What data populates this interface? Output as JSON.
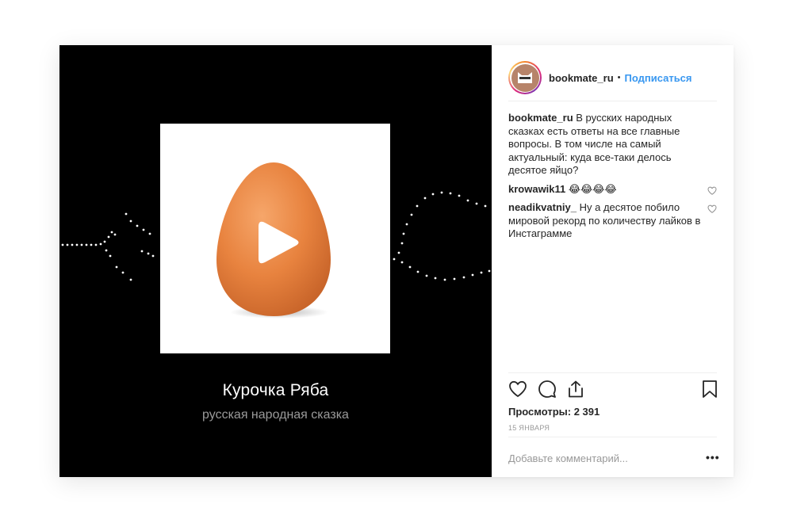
{
  "post": {
    "author": "bookmate_ru",
    "separator": "•",
    "follow_label": "Подписаться",
    "caption_text": "В русских народных сказках есть ответы на все главные вопросы. В том числе на самый актуальный: куда все-таки делось десятое яйцо?",
    "comments": [
      {
        "user": "krowawik11",
        "text": "😂😂😂😂"
      },
      {
        "user": "neadikvatniy_",
        "text": "Ну а десятое побило мировой рекорд по количеству лайков в Инстаграмме"
      }
    ],
    "views_label": "Просмотры: 2 391",
    "date": "15 ЯНВАРЯ",
    "add_comment_placeholder": "Добавьте комментарий...",
    "more_label": "•••"
  },
  "media": {
    "book_title": "Курочка Ряба",
    "book_subtitle": "русская народная сказка"
  },
  "icons": {
    "like": "heart-icon",
    "comment": "comment-icon",
    "share": "share-icon",
    "save": "bookmark-icon",
    "play": "play-icon",
    "comment_like": "heart-icon"
  },
  "colors": {
    "follow": "#3897f0",
    "media_background": "#000000",
    "egg": "#e8833f"
  }
}
